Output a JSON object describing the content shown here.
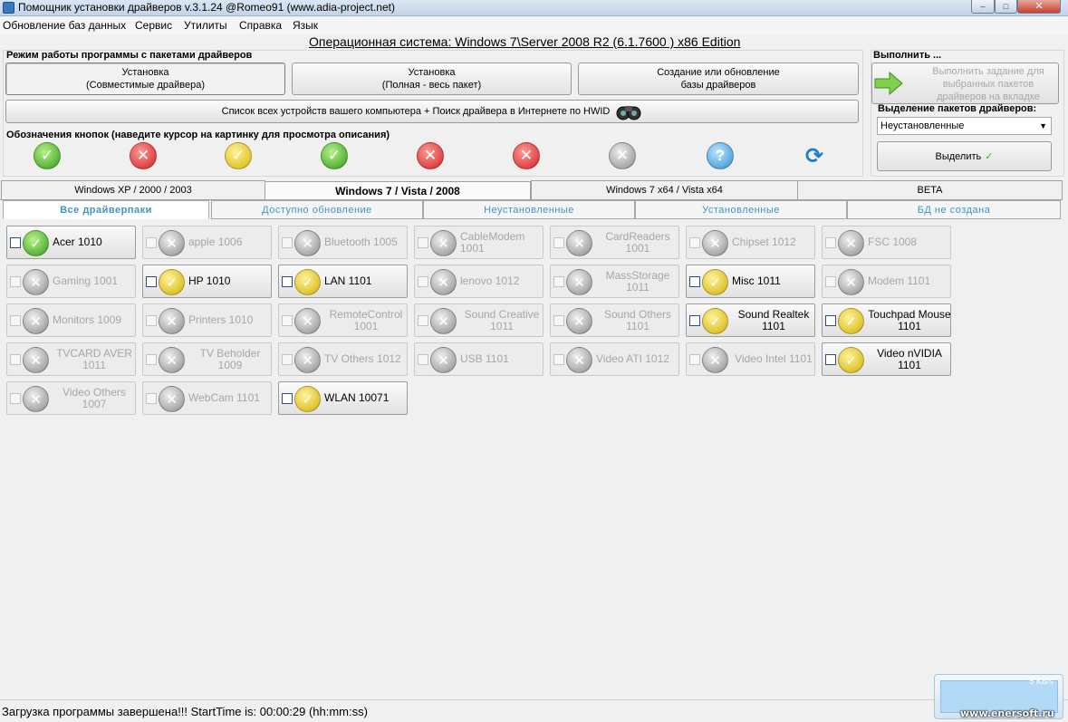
{
  "window": {
    "title": "Помощник установки драйверов v.3.1.24 @Romeo91 (www.adia-project.net)",
    "min_glyph": "–",
    "max_glyph": "□",
    "close_glyph": "✕"
  },
  "menu": [
    "Обновление баз данных",
    "Сервис",
    "Утилиты",
    "Справка",
    "Язык"
  ],
  "os_title": "Операционная система: Windows 7\\Server 2008 R2  (6.1.7600 ) x86 Edition",
  "mode": {
    "label": "Режим работы программы с пакетами драйверов",
    "buttons": [
      {
        "line1": "Установка",
        "line2": "(Совместимые драйвера)"
      },
      {
        "line1": "Установка",
        "line2": "(Полная - весь пакет)"
      },
      {
        "line1": "Создание или обновление",
        "line2": "базы драйверов"
      }
    ],
    "devices_button": "Список всех устройств вашего компьютера + Поиск драйвера в Интернете по HWID"
  },
  "legend": {
    "label": "Обозначения кнопок (наведите курсор на картинку для просмотра описания)",
    "icons": [
      "green-check",
      "red-cross",
      "yellow-check",
      "green-check-arrow",
      "red-cross-refresh",
      "red-cross-arrow",
      "gray-cross",
      "blue-question",
      "blue-refresh"
    ]
  },
  "execute": {
    "label": "Выполнить ...",
    "button_text": "Выполнить задание для выбранных пакетов драйверов на вкладке"
  },
  "select": {
    "label": "Выделение пакетов драйверов:",
    "value": "Неустановленные",
    "button": "Выделить"
  },
  "os_tabs": [
    "Windows XP / 2000 / 2003",
    "Windows 7 / Vista / 2008",
    "Windows 7 x64 / Vista x64",
    "BETA"
  ],
  "os_tab_active": 1,
  "filter_tabs": [
    "Все драйверпаки",
    "Доступно обновление",
    "Неустановленные",
    "Установленные",
    "БД не создана"
  ],
  "filter_tab_active": 0,
  "drivers": [
    {
      "name": "Acer 1010",
      "status": "green",
      "enabled": true
    },
    {
      "name": "apple 1006",
      "status": "gray",
      "enabled": false
    },
    {
      "name": "Bluetooth 1005",
      "status": "gray",
      "enabled": false
    },
    {
      "name": "CableModem 1001",
      "status": "gray",
      "enabled": false
    },
    {
      "name": "CardReaders 1001",
      "status": "gray",
      "enabled": false
    },
    {
      "name": "Chipset 1012",
      "status": "gray",
      "enabled": false
    },
    {
      "name": "FSC 1008",
      "status": "gray",
      "enabled": false
    },
    {
      "name": "Gaming 1001",
      "status": "gray",
      "enabled": false
    },
    {
      "name": "HP 1010",
      "status": "yellow",
      "enabled": true
    },
    {
      "name": "LAN 1101",
      "status": "yellow",
      "enabled": true
    },
    {
      "name": "lenovo 1012",
      "status": "gray",
      "enabled": false
    },
    {
      "name": "MassStorage 1011",
      "status": "gray",
      "enabled": false
    },
    {
      "name": "Misc 1011",
      "status": "yellow",
      "enabled": true
    },
    {
      "name": "Modem 1101",
      "status": "gray",
      "enabled": false
    },
    {
      "name": "Monitors 1009",
      "status": "gray",
      "enabled": false
    },
    {
      "name": "Printers 1010",
      "status": "gray",
      "enabled": false
    },
    {
      "name": "RemoteControl 1001",
      "status": "gray",
      "enabled": false
    },
    {
      "name": "Sound Creative 1011",
      "status": "gray",
      "enabled": false
    },
    {
      "name": "Sound Others 1101",
      "status": "gray",
      "enabled": false
    },
    {
      "name": "Sound Realtek 1101",
      "status": "yellow",
      "enabled": true
    },
    {
      "name": "Touchpad Mouse 1101",
      "status": "yellow",
      "enabled": true
    },
    {
      "name": "TVCARD AVER 1011",
      "status": "gray",
      "enabled": false
    },
    {
      "name": "TV Beholder 1009",
      "status": "gray",
      "enabled": false
    },
    {
      "name": "TV Others 1012",
      "status": "gray",
      "enabled": false
    },
    {
      "name": "USB 1101",
      "status": "gray",
      "enabled": false
    },
    {
      "name": "Video ATI 1012",
      "status": "gray",
      "enabled": false
    },
    {
      "name": "Video Intel 1101",
      "status": "gray",
      "enabled": false
    },
    {
      "name": "Video nVIDIA 1101",
      "status": "yellow",
      "enabled": true
    },
    {
      "name": "Video Others 1007",
      "status": "gray",
      "enabled": false
    },
    {
      "name": "WebCam 1101",
      "status": "gray",
      "enabled": false
    },
    {
      "name": "WLAN 10071",
      "status": "yellow",
      "enabled": true
    }
  ],
  "status_text": "Загрузка программы завершена!!! StartTime is: 00:00:29 (hh:mm:ss)",
  "net_speed": "5 KB/s",
  "watermark": "www.enersoft.ru"
}
